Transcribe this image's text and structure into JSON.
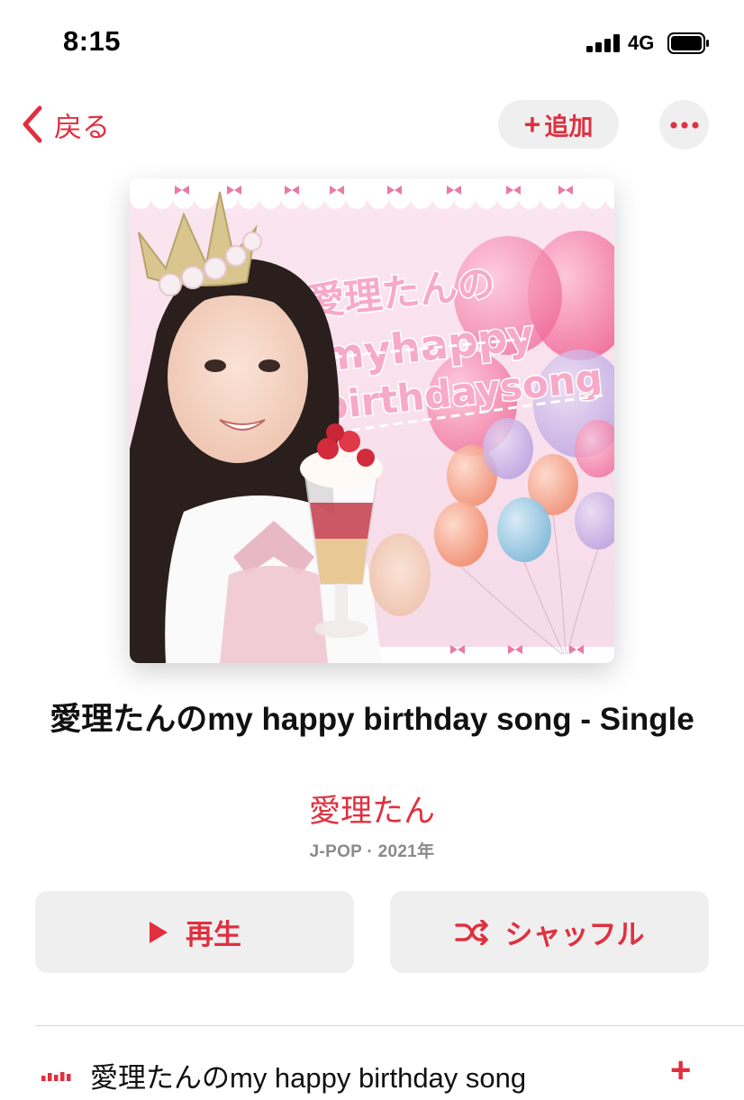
{
  "status_bar": {
    "time": "8:15",
    "network": "4G"
  },
  "nav": {
    "back_label": "戻る",
    "add_label": "追加"
  },
  "artwork": {
    "text_line1": "愛理たんの",
    "text_line2": "myhappy",
    "text_line3": "birthdaysong"
  },
  "album": {
    "title": "愛理たんのmy happy birthday song - Single",
    "artist": "愛理たん",
    "meta": "J-POP · 2021年"
  },
  "actions": {
    "play_label": "再生",
    "shuffle_label": "シャッフル"
  },
  "tracks": [
    {
      "title": "愛理たんのmy happy birthday song",
      "now_playing": true
    }
  ],
  "colors": {
    "accent": "#e0303f",
    "button_bg": "#efeff0",
    "secondary_text": "#8a8a8e"
  }
}
